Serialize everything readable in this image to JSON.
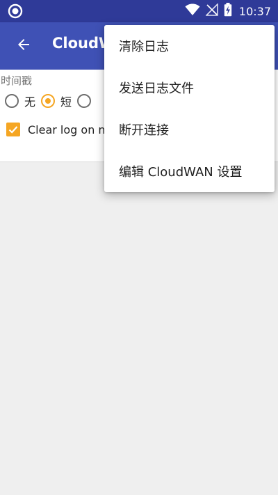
{
  "status_bar": {
    "time": "10:37",
    "icons": [
      "circle-record-icon",
      "wifi-icon",
      "no-signal-icon",
      "battery-charging-icon"
    ],
    "background": "#2f3a98"
  },
  "app_bar": {
    "title": "CloudWAN",
    "back_icon": "back-arrow-icon",
    "background": "#3f51b5"
  },
  "settings": {
    "timestamp_label": "时间戳",
    "radio_options": [
      {
        "label": "无",
        "checked": false
      },
      {
        "label": "短",
        "checked": true
      },
      {
        "label": "",
        "checked": false
      }
    ],
    "checkbox": {
      "label": "Clear log on new connection",
      "checked": true
    },
    "accent_color": "#f5a623"
  },
  "overflow_menu": {
    "items": [
      {
        "label": "清除日志"
      },
      {
        "label": "发送日志文件"
      },
      {
        "label": "断开连接"
      },
      {
        "label": "编辑 CloudWAN 设置"
      }
    ]
  }
}
